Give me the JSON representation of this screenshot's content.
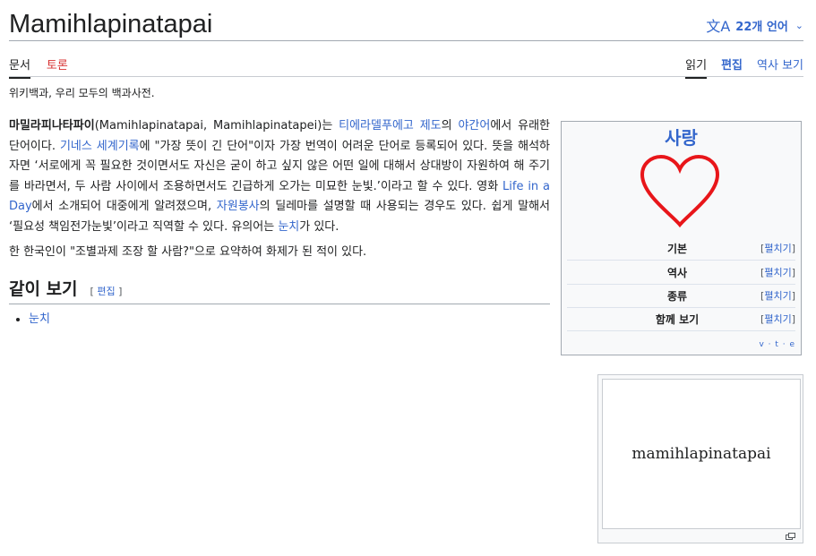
{
  "header": {
    "title": "Mamihlapinatapai",
    "language_button": "22개 언어",
    "language_icon": "translate-icon"
  },
  "tabs_left": [
    {
      "label": "문서",
      "selected": true
    },
    {
      "label": "토론",
      "selected": false
    }
  ],
  "tabs_right": [
    {
      "label": "읽기",
      "selected": true
    },
    {
      "label": "편집",
      "selected": false
    },
    {
      "label": "역사 보기",
      "selected": false
    }
  ],
  "tagline": "위키백과, 우리 모두의 백과사전.",
  "article": {
    "p1": {
      "s1_bold": "마밀라피나타파이",
      "s2": "(Mamihlapinatapai, Mamihlapinatapei)는 ",
      "l1": "티에라델푸에고 제도",
      "s3": "의 ",
      "l2": "야간어",
      "s4": "에서 유래한 단어이다. ",
      "l3": "기네스 세계기록",
      "s5": "에 \"가장 뜻이 긴 단어\"이자 가장 번역이 어려운 단어로 등록되어 있다. 뜻을 해석하자면 ‘서로에게 꼭 필요한 것이면서도 자신은 굳이 하고 싶지 않은 어떤 일에 대해서 상대방이 자원하여 해 주기를 바라면서, 두 사람 사이에서 조용하면서도 긴급하게 오가는 미묘한 눈빛.’이라고 할 수 있다. 영화 ",
      "l4": "Life in a Day",
      "s6": "에서 소개되어 대중에게 알려졌으며, ",
      "l5": "자원봉사",
      "s7": "의 딜레마를 설명할 때 사용되는 경우도 있다. 쉽게 말해서 ‘필요성 책임전가눈빛’이라고 직역할 수 있다. 유의어는 ",
      "l6": "눈치",
      "s8": "가 있다."
    },
    "p2": "한 한국인이 \"조별과제 조장 할 사람?\"으로 요약하여 화제가 된 적이 있다.",
    "see_also_heading": "같이 보기",
    "edit_open": "[ ",
    "edit_label": "편집",
    "edit_close": " ]",
    "see_also_items": [
      "눈치"
    ]
  },
  "navbox": {
    "title": "사랑",
    "rows": [
      {
        "label": "기본",
        "toggle": "펼치기"
      },
      {
        "label": "역사",
        "toggle": "펼치기"
      },
      {
        "label": "종류",
        "toggle": "펼치기"
      },
      {
        "label": "함께 보기",
        "toggle": "펼치기"
      }
    ],
    "toggle_open": "[",
    "toggle_close": "]",
    "vte": "v · t · e",
    "heart_color": "#e8161a"
  },
  "image_box": {
    "caption_text": "mamihlapinatapai"
  },
  "colors": {
    "link": "#3366cc",
    "new_link": "#d73333",
    "text": "#202122"
  }
}
